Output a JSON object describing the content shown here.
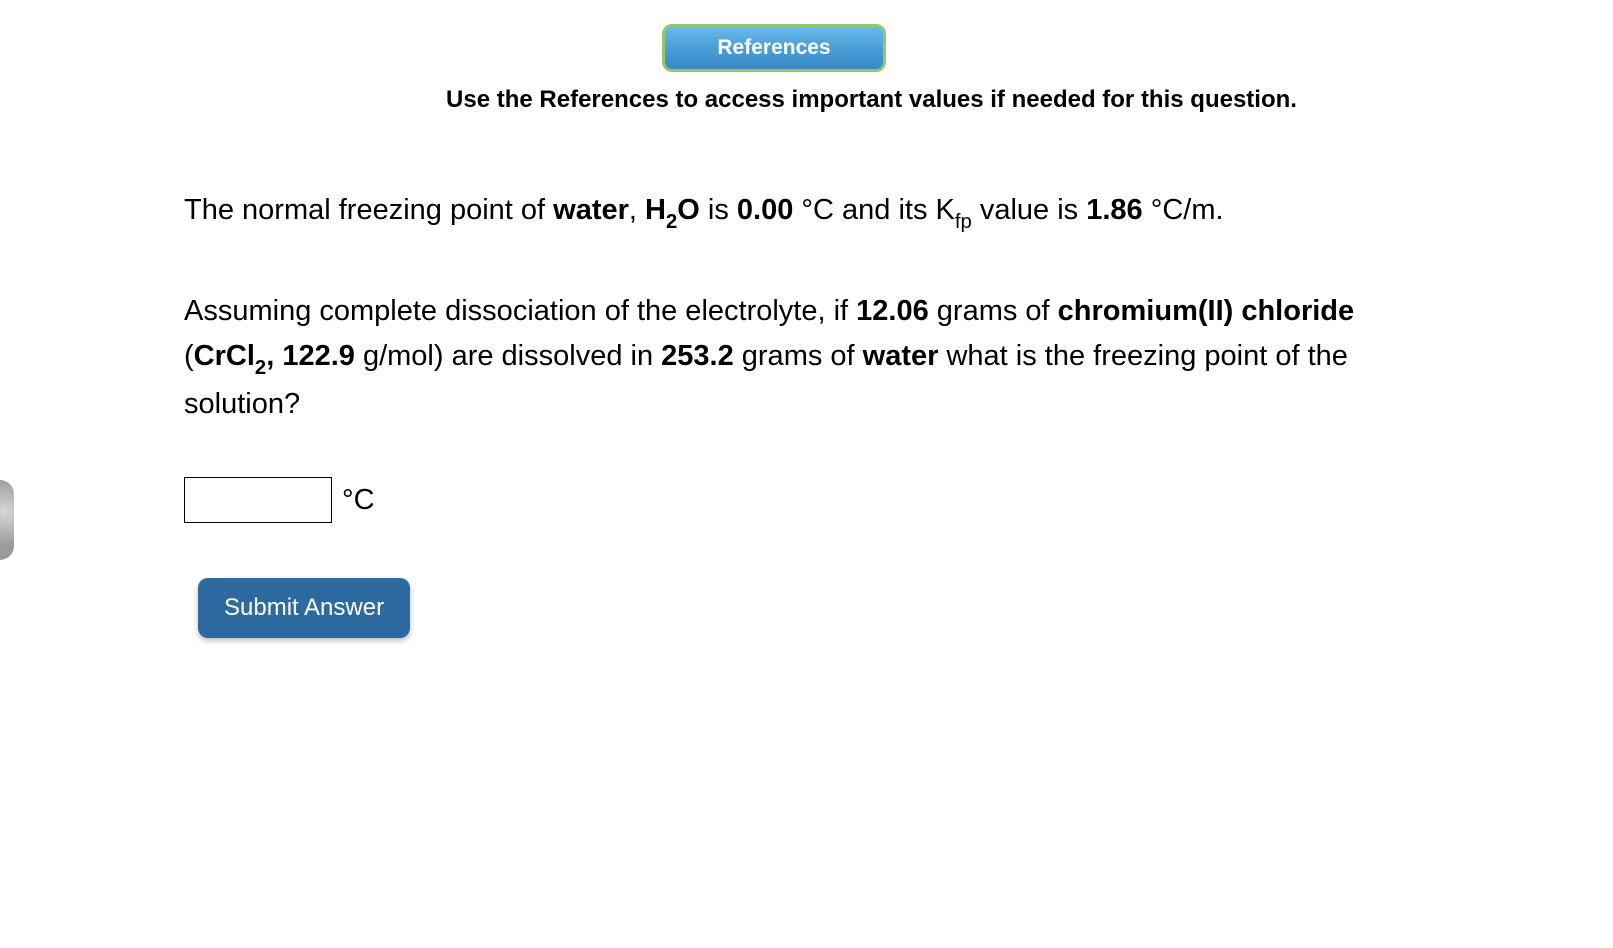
{
  "references_button_label": "References",
  "hint": "Use the References to access important values if needed for this question.",
  "l1": {
    "t1": "The normal freezing point of ",
    "solvent": "water",
    "t2": ", ",
    "f_h": "H",
    "f_2": "2",
    "f_o": "O",
    "t3": " is ",
    "fp": "0.00",
    "t4": " °C and its K",
    "k_sub": "fp",
    "t5": " value is ",
    "kfp": "1.86",
    "t6": " °C/m."
  },
  "l2": {
    "t1": "Assuming complete dissociation of the electrolyte, if ",
    "mass_solute": "12.06",
    "t2": " grams of ",
    "solute": "chromium(II) chloride",
    "t3": " (",
    "formula_a": "CrCl",
    "formula_sub": "2",
    "t4": ", ",
    "molar_mass": "122.9",
    "t5": " g/mol) are dissolved in ",
    "mass_solvent": "253.2",
    "t6": " grams of ",
    "solvent": "water",
    "t7": " what is the freezing point of the solution?"
  },
  "answer_value": "",
  "unit": "°C",
  "submit_label": "Submit Answer"
}
